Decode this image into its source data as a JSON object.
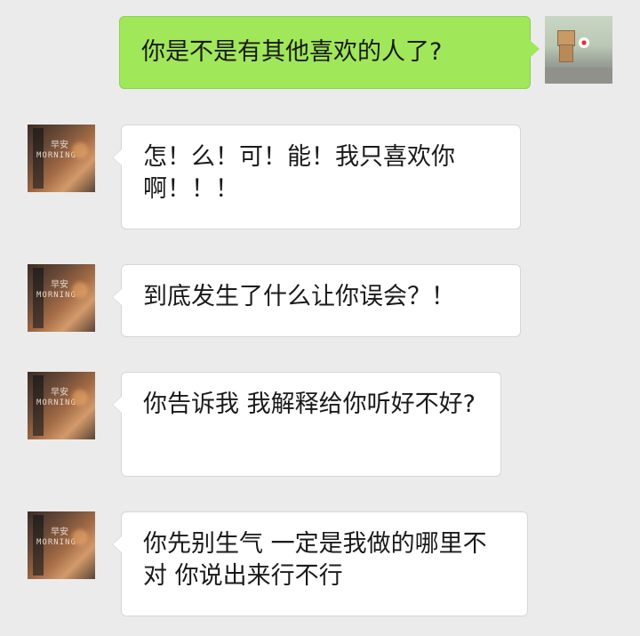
{
  "colors": {
    "background": "#ebebeb",
    "self_bubble": "#a0e75a",
    "other_bubble": "#ffffff"
  },
  "self_avatar": {
    "icon": "robot-with-flower-avatar"
  },
  "other_avatar": {
    "icon": "morning-photo-avatar",
    "caption": "MORNING",
    "mark": "早安"
  },
  "messages": [
    {
      "sender": "self",
      "text": "你是不是有其他喜欢的人了?"
    },
    {
      "sender": "other",
      "text": "怎！么！可！能！我只喜欢你啊！！！"
    },
    {
      "sender": "other",
      "text": "到底发生了什么让你误会？！"
    },
    {
      "sender": "other",
      "text": "你告诉我 我解释给你听好不好?"
    },
    {
      "sender": "other",
      "text": "你先别生气 一定是我做的哪里不对 你说出来行不行"
    }
  ]
}
